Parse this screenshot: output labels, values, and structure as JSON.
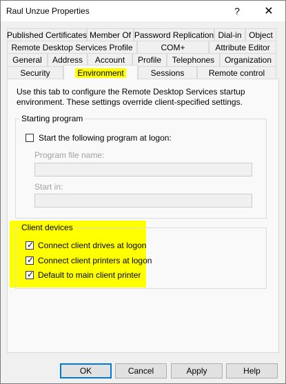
{
  "window": {
    "title": "Raul Unzue Properties",
    "help_glyph": "?",
    "close_glyph": "✕"
  },
  "tabs": {
    "row1": [
      "Published Certificates",
      "Member Of",
      "Password Replication",
      "Dial-in",
      "Object"
    ],
    "row2": [
      "Remote Desktop Services Profile",
      "COM+",
      "Attribute Editor"
    ],
    "row3": [
      "General",
      "Address",
      "Account",
      "Profile",
      "Telephones",
      "Organization"
    ],
    "row4": [
      "Security",
      "Environment",
      "Sessions",
      "Remote control"
    ],
    "active": "Environment"
  },
  "environment": {
    "description": "Use this tab to configure the Remote Desktop Services startup environment. These settings override client-specified settings.",
    "starting_program": {
      "group_label": "Starting program",
      "start_program_label": "Start the following program at logon:",
      "start_program_checked": false,
      "program_file_label": "Program file name:",
      "program_file_value": "",
      "start_in_label": "Start in:",
      "start_in_value": ""
    },
    "client_devices": {
      "group_label": "Client devices",
      "items": [
        {
          "label": "Connect client drives at logon",
          "checked": true
        },
        {
          "label": "Connect client printers at logon",
          "checked": true
        },
        {
          "label": "Default to main client printer",
          "checked": true
        }
      ]
    }
  },
  "buttons": {
    "ok": "OK",
    "cancel": "Cancel",
    "apply": "Apply",
    "help": "Help"
  },
  "colors": {
    "highlight": "#ffff00",
    "default_button_border": "#0078d7"
  }
}
